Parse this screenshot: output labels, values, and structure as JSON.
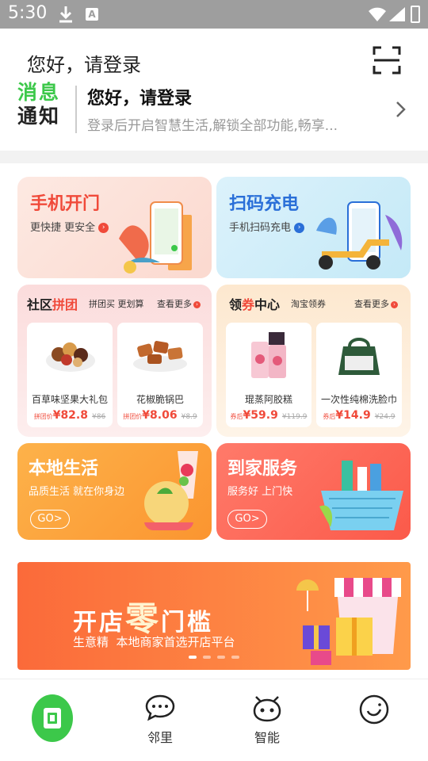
{
  "status_bar": {
    "time": "5:30",
    "notification_icon": "A"
  },
  "header": {
    "greeting": "您好，请登录",
    "notice": {
      "logo_line1": "消息",
      "logo_line2": "通知",
      "title": "您好，请登录",
      "subtitle": "登录后开启智慧生活,解锁全部功能,畅享..."
    }
  },
  "services": {
    "door": {
      "title": "手机开门",
      "subtitle": "更快捷 更安全"
    },
    "charge": {
      "title": "扫码充电",
      "subtitle": "手机扫码充电"
    }
  },
  "group_buy": {
    "title_a": "社区",
    "title_b": "拼团",
    "slogan": "拼团买 更划算",
    "more": "查看更多",
    "products": [
      {
        "name": "百草味坚果大礼包",
        "price_label": "拼团价",
        "price": "¥82.8",
        "original": "¥86"
      },
      {
        "name": "花椒脆锅巴",
        "price_label": "拼团价",
        "price": "¥8.06",
        "original": "¥8.9"
      }
    ]
  },
  "coupons": {
    "title_a": "领",
    "title_b": "券",
    "title_c": "中心",
    "slogan": "淘宝领券",
    "more": "查看更多",
    "products": [
      {
        "name": "琨蒸阿胶糕",
        "price_label": "券后",
        "price": "¥59.9",
        "original": "¥119.9"
      },
      {
        "name": "一次性纯棉洗脸巾",
        "price_label": "券后",
        "price": "¥14.9",
        "original": "¥24.9"
      }
    ]
  },
  "local_life": {
    "title": "本地生活",
    "subtitle": "品质生活 就在你身边",
    "go": "GO>"
  },
  "home_service": {
    "title": "到家服务",
    "subtitle": "服务好 上门快",
    "go": "GO>"
  },
  "banner": {
    "title_a": "开店",
    "title_b": "零",
    "title_c": "门槛",
    "subtitle": "生意精  本地商家首选开店平台",
    "dots": 4
  },
  "tabs": [
    {
      "label": "",
      "icon": "home-icon"
    },
    {
      "label": "邻里",
      "icon": "chat-bubble-icon"
    },
    {
      "label": "智能",
      "icon": "robot-icon"
    },
    {
      "label": "",
      "icon": "smiley-icon"
    }
  ],
  "colors": {
    "accent_green": "#3cc84a",
    "red": "#f04a3a",
    "blue": "#2a6fd8",
    "orange": "#ff7a2a"
  }
}
